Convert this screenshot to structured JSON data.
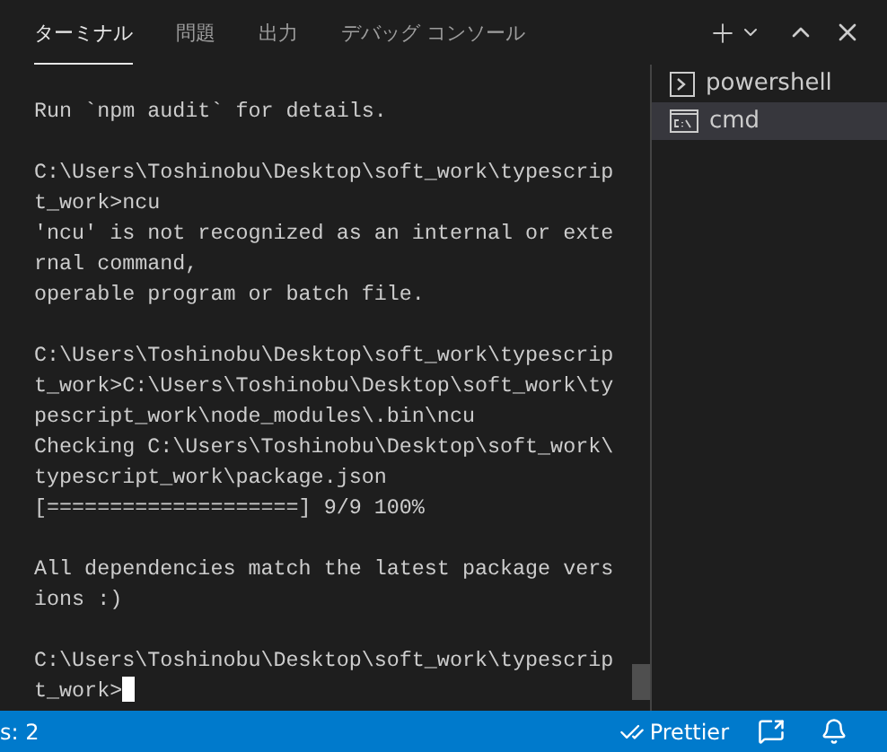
{
  "tabs": [
    {
      "label": "ターミナル",
      "selected": true
    },
    {
      "label": "問題",
      "selected": false
    },
    {
      "label": "出力",
      "selected": false
    },
    {
      "label": "デバッグ コンソール",
      "selected": false
    }
  ],
  "terminal": {
    "blocks": [
      [
        "Run `npm audit` for details."
      ],
      [
        "C:\\Users\\Toshinobu\\Desktop\\soft_work\\typescrip",
        "t_work>ncu",
        "'ncu' is not recognized as an internal or exte",
        "rnal command,",
        "operable program or batch file."
      ],
      [
        "C:\\Users\\Toshinobu\\Desktop\\soft_work\\typescrip",
        "t_work>C:\\Users\\Toshinobu\\Desktop\\soft_work\\ty",
        "pescript_work\\node_modules\\.bin\\ncu",
        "Checking C:\\Users\\Toshinobu\\Desktop\\soft_work\\",
        "typescript_work\\package.json",
        "[====================] 9/9 100%"
      ],
      [
        "All dependencies match the latest package vers",
        "ions :)"
      ],
      [
        "C:\\Users\\Toshinobu\\Desktop\\soft_work\\typescrip",
        "t_work>"
      ]
    ],
    "cursor": true
  },
  "terminal_list": [
    {
      "kind": "powershell",
      "label": "powershell",
      "selected": false
    },
    {
      "kind": "cmd",
      "label": "cmd",
      "selected": true
    }
  ],
  "status_bar": {
    "left": "s: 2",
    "prettier": "Prettier"
  }
}
